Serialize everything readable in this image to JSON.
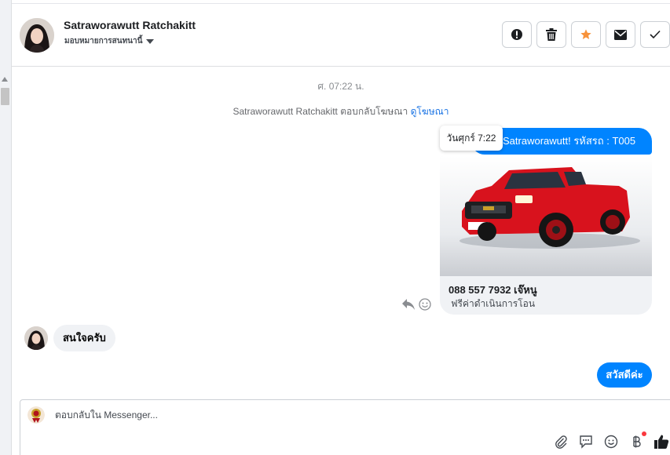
{
  "header": {
    "name": "Satraworawutt Ratchakitt",
    "assign_label": "มอบหมายการสนทนานี้",
    "actions": [
      "mark-spam-icon",
      "trash-icon",
      "star-icon",
      "envelope-icon",
      "check-icon"
    ]
  },
  "thread": {
    "timestamp": "ศ. 07:22 น.",
    "replied_text": "Satraworawutt Ratchakitt ตอบกลับโฆษณา",
    "replied_link": "ดูโฆษณา",
    "tooltip": "วันศุกร์ 7:22",
    "outgoing_first": "Satraworawutt! รหัสรถ : T005",
    "card": {
      "phone": "088 557 7932 เจ๊หนู",
      "subtitle": "ฟรีค่าดำเนินการโอน"
    },
    "incoming_text": "สนใจครับ",
    "outgoing_second": "สวัสดีค่ะ"
  },
  "composer": {
    "placeholder": "ตอบกลับใน Messenger..."
  },
  "colors": {
    "messenger_blue": "#0084ff",
    "link_blue": "#1b74e4",
    "star_orange": "#f7923b",
    "bubble_gray": "#f0f2f5"
  }
}
